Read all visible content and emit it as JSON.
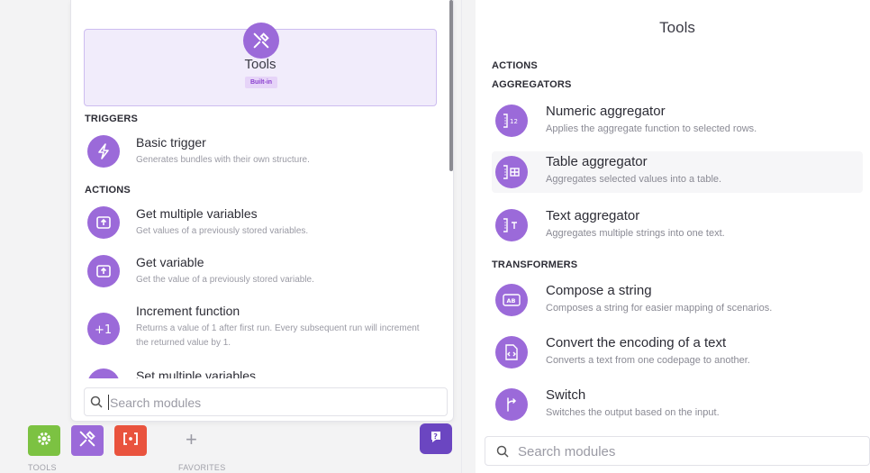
{
  "left_panel": {
    "app": {
      "name": "Tools",
      "badge": "Built-in",
      "icon": "tools-icon"
    },
    "triggers_label": "TRIGGERS",
    "actions_label": "ACTIONS",
    "triggers": [
      {
        "title": "Basic trigger",
        "desc": "Generates bundles with their own structure.",
        "icon": "lightning-icon"
      }
    ],
    "actions": [
      {
        "title": "Get multiple variables",
        "desc": "Get values of a previously stored variables.",
        "icon": "variable-upload-icon"
      },
      {
        "title": "Get variable",
        "desc": "Get the value of a previously stored variable.",
        "icon": "variable-upload-icon"
      },
      {
        "title": "Increment function",
        "desc": "Returns a value of 1 after first run. Every subsequent run will increment the returned value by 1.",
        "icon": "plus-one-icon"
      },
      {
        "title": "Set multiple variables",
        "desc": "",
        "icon": "brackets-icon"
      }
    ],
    "search": {
      "placeholder": "Search modules"
    }
  },
  "dock": {
    "tools_label": "TOOLS",
    "favorites_label": "FAVORITES",
    "plus": "+",
    "colors": {
      "gear": "#7cc242",
      "tools": "#9b6ad9",
      "brackets": "#e9533e",
      "help": "#6b46c1"
    }
  },
  "right_panel": {
    "title": "Tools",
    "actions_label": "ACTIONS",
    "aggregators_label": "AGGREGATORS",
    "transformers_label": "TRANSFORMERS",
    "aggregators": [
      {
        "title": "Numeric aggregator",
        "desc": "Applies the aggregate function to selected rows.",
        "icon": "numeric-aggregator-icon"
      },
      {
        "title": "Table aggregator",
        "desc": "Aggregates selected values into a table.",
        "icon": "table-aggregator-icon"
      },
      {
        "title": "Text aggregator",
        "desc": "Aggregates multiple strings into one text.",
        "icon": "text-aggregator-icon"
      }
    ],
    "transformers": [
      {
        "title": "Compose a string",
        "desc": "Composes a string for easier mapping of scenarios.",
        "icon": "compose-string-icon"
      },
      {
        "title": "Convert the encoding of a text",
        "desc": "Converts a text from one codepage to another.",
        "icon": "encoding-icon"
      },
      {
        "title": "Switch",
        "desc": "Switches the output based on the input.",
        "icon": "switch-icon"
      }
    ],
    "search": {
      "placeholder": "Search modules"
    }
  },
  "accent": "#9b6ad9"
}
